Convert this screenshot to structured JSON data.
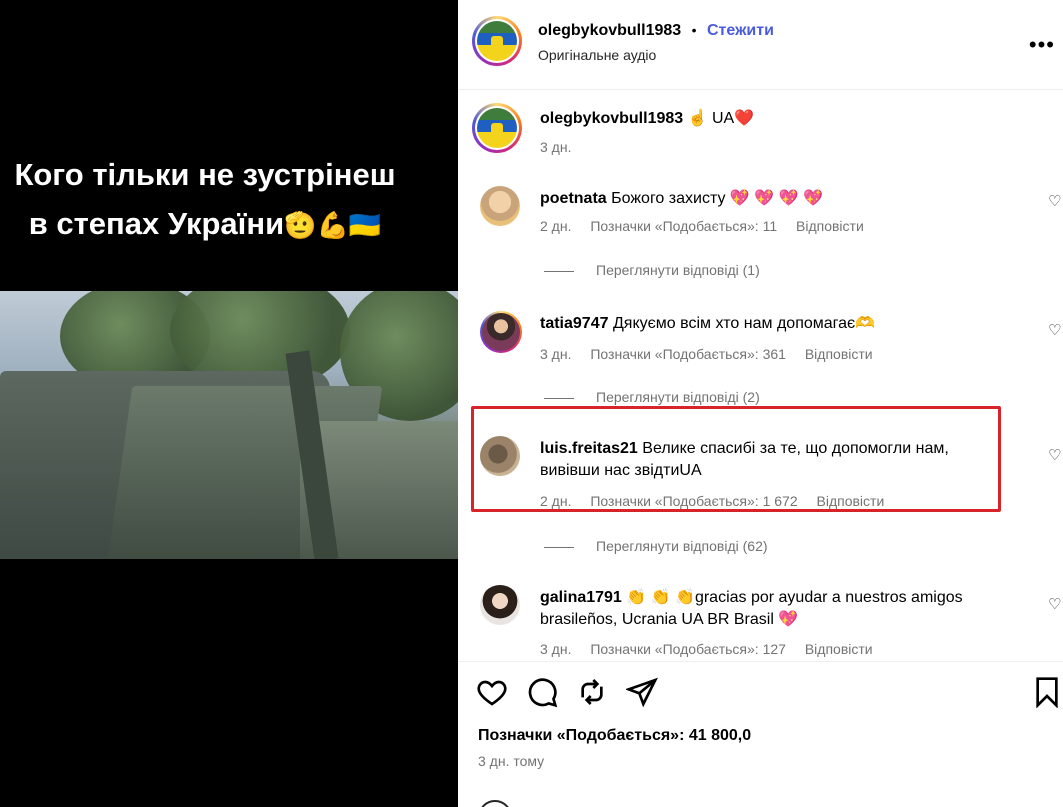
{
  "video": {
    "caption_line1": "Кого тільки не зустрінеш",
    "caption_line2": "в степах України",
    "caption_emojis": "🫡💪🇺🇦"
  },
  "post": {
    "author": "olegbykovbull1983",
    "dot": "•",
    "follow_label": "Стежити",
    "audio": "Оригінальне аудіо",
    "more_icon": "more-horizontal-icon"
  },
  "caption_comment": {
    "username": "olegbykovbull1983",
    "text": "☝️ UA❤️",
    "time": "3 дн."
  },
  "comments": [
    {
      "username": "poetnata",
      "text": "Божого захисту 💖 💖 💖 💖",
      "time": "2 дн.",
      "likes": "Позначки «Подобається»: 11",
      "reply_label": "Відповісти",
      "view_replies": "Переглянути відповіді (1)"
    },
    {
      "username": "tatia9747",
      "text": "Дякуємо всім хто нам допомагає🫶",
      "time": "3 дн.",
      "likes": "Позначки «Подобається»: 361",
      "reply_label": "Відповісти",
      "view_replies": "Переглянути відповіді (2)"
    },
    {
      "username": "luis.freitas21",
      "text": "Велике спасибі за те, що допомогли нам, вивівши нас звідтиUA",
      "time": "2 дн.",
      "likes": "Позначки «Подобається»: 1 672",
      "reply_label": "Відповісти",
      "view_replies": "Переглянути відповіді (62)"
    },
    {
      "username": "galina1791",
      "text": "👏 👏 👏gracias por ayudar a nuestros amigos brasileños, Ucrania UA BR Brasil 💖",
      "time": "3 дн.",
      "likes": "Позначки «Подобається»: 127",
      "reply_label": "Відповісти"
    }
  ],
  "footer": {
    "likes_total": "Позначки «Подобається»: 41 800,0",
    "posted_ago": "3 дн. тому"
  },
  "icons": [
    "heart-icon",
    "comment-icon",
    "repost-icon",
    "share-icon",
    "bookmark-icon"
  ],
  "colors": {
    "follow": "#4a5cdb",
    "highlight": "#d9232b",
    "meta": "#737373"
  }
}
